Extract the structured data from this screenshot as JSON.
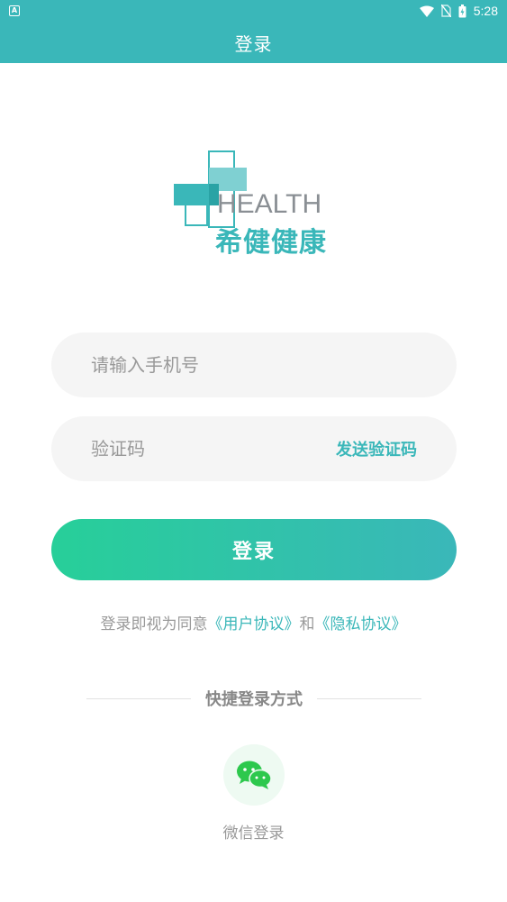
{
  "status_bar": {
    "app_icon": "A",
    "time": "5:28",
    "icons": [
      "wifi-icon",
      "no-sim-icon",
      "battery-charging-icon"
    ]
  },
  "header": {
    "title": "登录"
  },
  "logo": {
    "word": "HEALTH",
    "cn_name": "希健健康",
    "colors": {
      "teal": "#3ab7b9",
      "light_teal": "#7fd0d2",
      "gray": "#8a8f94"
    }
  },
  "form": {
    "phone_placeholder": "请输入手机号",
    "code_placeholder": "验证码",
    "send_code_label": "发送验证码",
    "login_label": "登录"
  },
  "agreement": {
    "prefix": "登录即视为同意",
    "user_agreement": "《用户协议》",
    "and": "和",
    "privacy_policy": "《隐私协议》"
  },
  "quick_login": {
    "title": "快捷登录方式",
    "wechat_label": "微信登录"
  },
  "colors": {
    "brand": "#3ab7b9",
    "gradient_start": "#27cf99",
    "wechat_green": "#2dc84d"
  }
}
